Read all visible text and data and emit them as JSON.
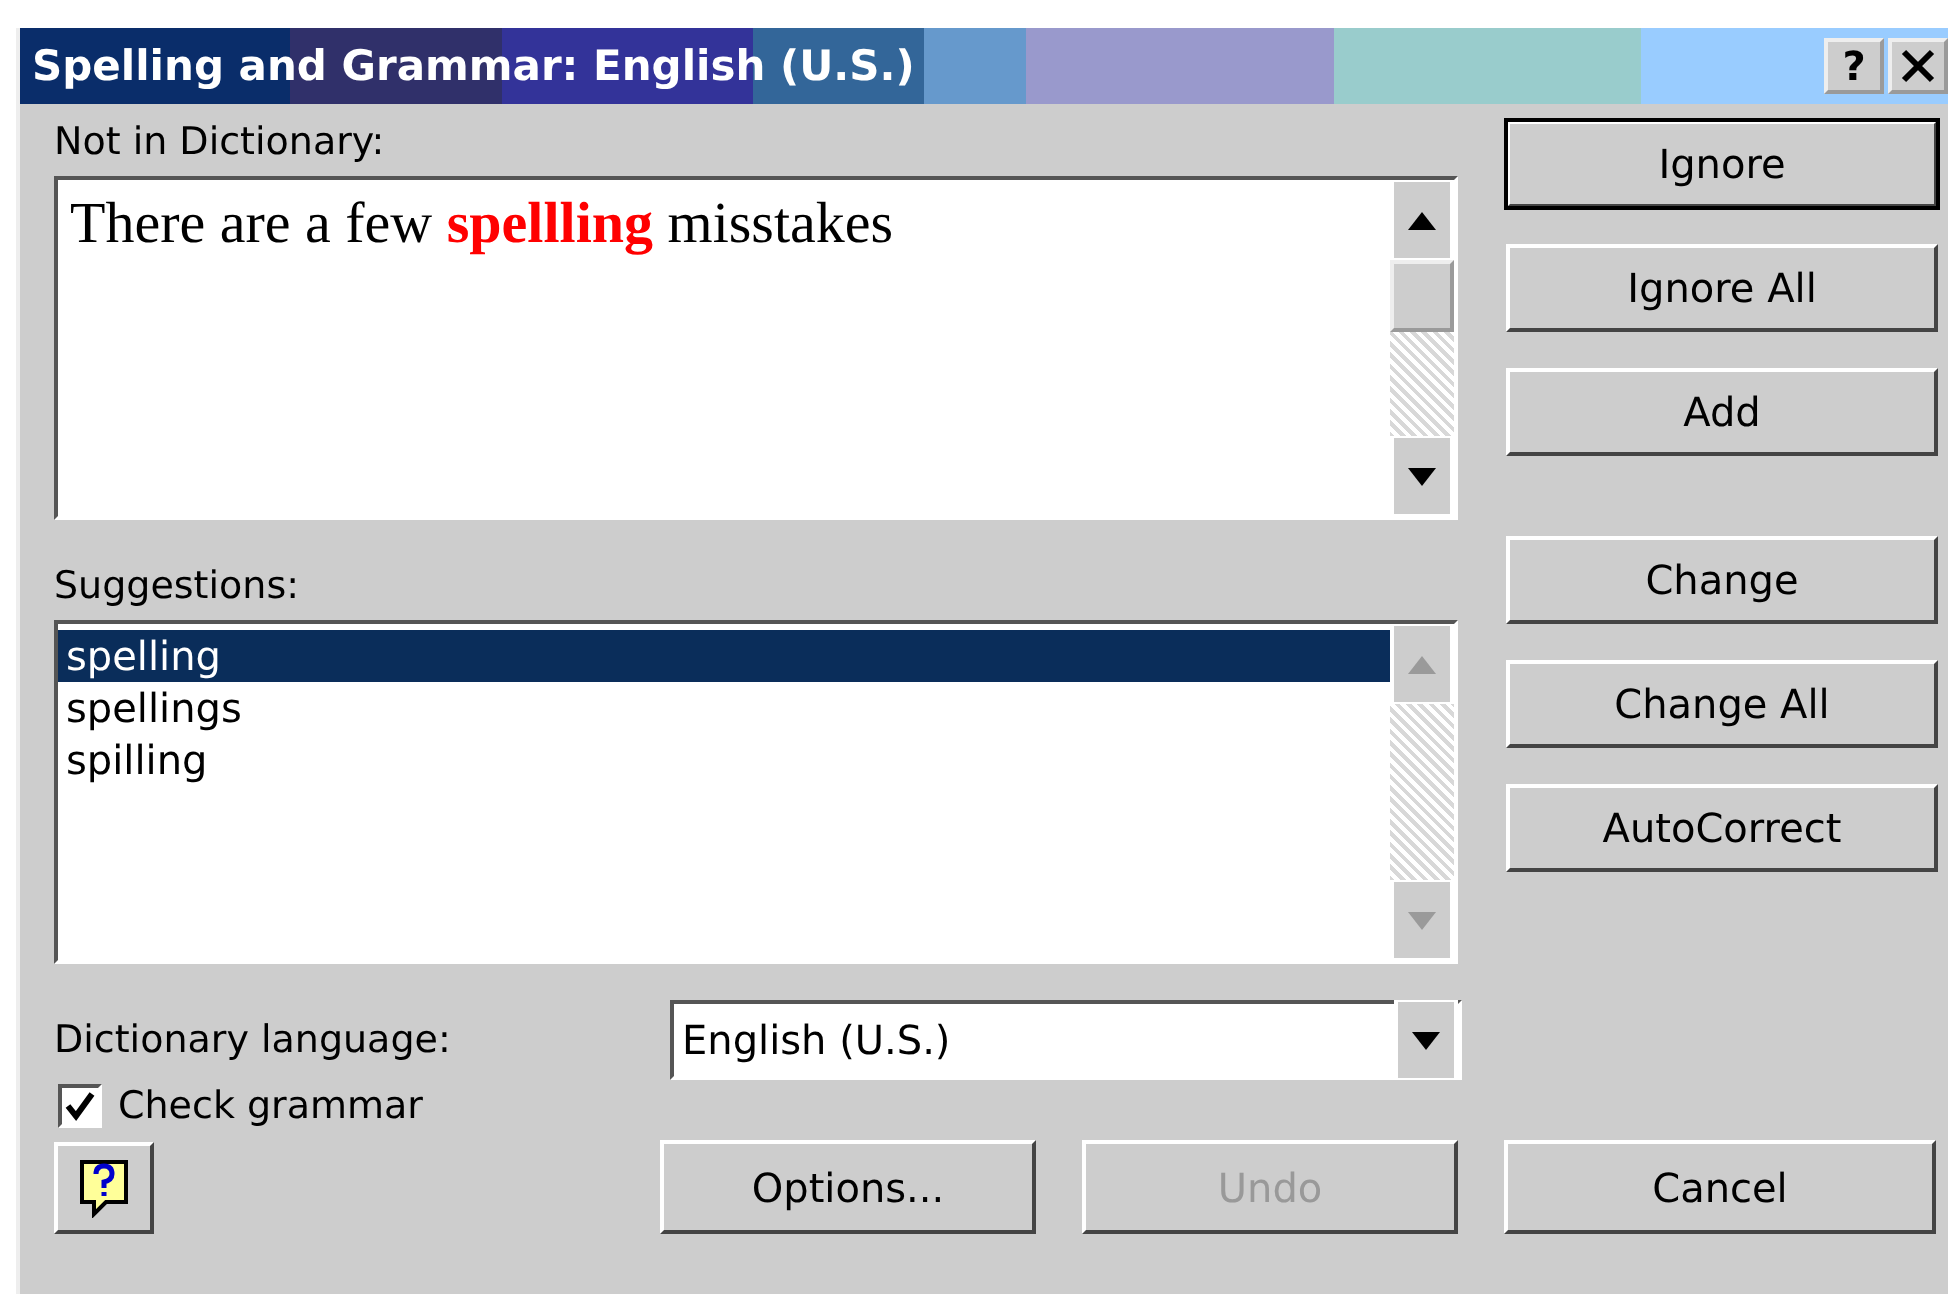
{
  "window": {
    "title": "Spelling and Grammar: English (U.S.)",
    "help_label": "?"
  },
  "not_in_dictionary": {
    "label": "Not in Dictionary:",
    "text": "There are a few **spellling** misstakes"
  },
  "suggestions": {
    "label": "Suggestions:",
    "items": [
      {
        "text": "spelling",
        "selected": true
      },
      {
        "text": "spellings",
        "selected": false
      },
      {
        "text": "spilling",
        "selected": false
      }
    ]
  },
  "side_button_groups": [
    [
      {
        "label": "Ignore",
        "default": true
      },
      {
        "label": "Ignore All",
        "default": false
      },
      {
        "label": "Add",
        "default": false
      }
    ],
    [
      {
        "label": "Change",
        "default": false
      },
      {
        "label": "Change All",
        "default": false
      },
      {
        "label": "AutoCorrect",
        "default": false
      }
    ]
  ],
  "dictionary_language": {
    "label": "Dictionary language:",
    "value": "English (U.S.)"
  },
  "check_grammar": {
    "label": "Check grammar",
    "checked": true
  },
  "bottom_buttons": [
    {
      "label": "Options...",
      "disabled": false
    },
    {
      "label": "Undo",
      "disabled": true
    },
    {
      "label": "Cancel",
      "disabled": false
    }
  ]
}
